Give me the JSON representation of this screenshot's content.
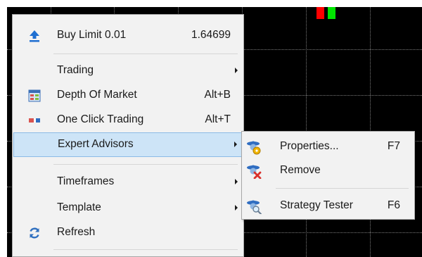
{
  "colors": {
    "chart_background": "#000000",
    "grid": "#7a7a7a",
    "candle_down": "#ff0000",
    "candle_up": "#00e600",
    "menu_background": "#f2f2f2",
    "highlight": "#cde4f7"
  },
  "context_menu": {
    "items": [
      {
        "label": "Buy Limit 0.01",
        "shortcut": "1.64699",
        "icon": "up-arrow-icon"
      },
      {
        "label": "Trading",
        "submenu": true
      },
      {
        "label": "Depth Of Market",
        "shortcut": "Alt+B",
        "icon": "depth-of-market-icon"
      },
      {
        "label": "One Click Trading",
        "shortcut": "Alt+T",
        "icon": "one-click-trading-icon"
      },
      {
        "label": "Expert Advisors",
        "submenu": true,
        "highlighted": true
      },
      {
        "label": "Timeframes",
        "submenu": true
      },
      {
        "label": "Template",
        "submenu": true
      },
      {
        "label": "Refresh",
        "icon": "refresh-icon"
      }
    ]
  },
  "expert_advisors_submenu": {
    "items": [
      {
        "label": "Properties...",
        "shortcut": "F7",
        "icon": "expert-properties-icon"
      },
      {
        "label": "Remove",
        "icon": "expert-remove-icon"
      },
      {
        "label": "Strategy Tester",
        "shortcut": "F6",
        "icon": "strategy-tester-icon"
      }
    ]
  }
}
